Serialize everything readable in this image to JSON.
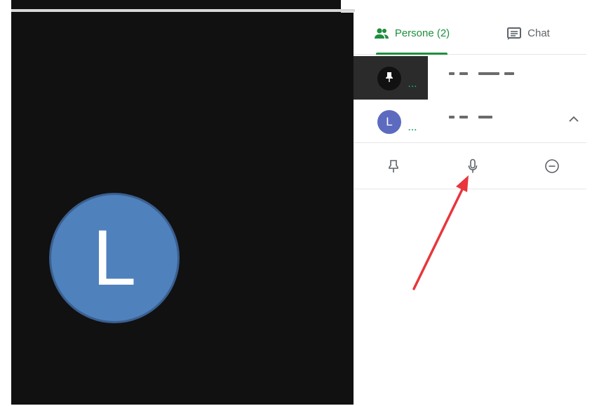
{
  "video": {
    "avatar_letter": "L",
    "avatar_color": "#4f81bd"
  },
  "panel": {
    "tabs": [
      {
        "label": "Persone (2)",
        "icon": "people-icon",
        "active": true
      },
      {
        "label": "Chat",
        "icon": "chat-icon",
        "active": false
      }
    ],
    "participants": [
      {
        "avatar": "pin-icon",
        "avatar_color": "#111111",
        "status": "..."
      },
      {
        "avatar": "L",
        "avatar_color": "#5c6bc0",
        "status": "...",
        "expanded": true
      }
    ],
    "actions": [
      {
        "icon": "pin-icon"
      },
      {
        "icon": "microphone-icon"
      },
      {
        "icon": "remove-icon"
      }
    ]
  },
  "colors": {
    "accent_green": "#1e8e3e",
    "annotation_arrow": "#e8363c"
  }
}
